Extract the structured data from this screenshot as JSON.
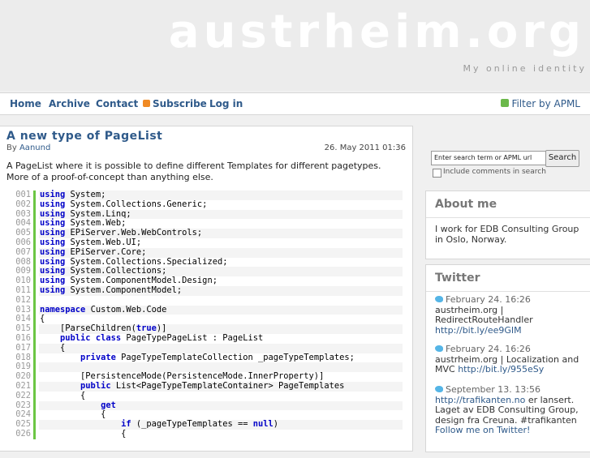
{
  "site": {
    "title": "austrheim.org",
    "tagline": "My online identity"
  },
  "nav": {
    "items": [
      "Home",
      "Archive",
      "Contact",
      "Subscribe",
      "Log in"
    ],
    "filter": "Filter by APML"
  },
  "post": {
    "title": "A new type of PageList",
    "by": "By",
    "author": "Aanund",
    "date": "26. May 2011 01:36",
    "intro": "A PageList where it is possible to define different Templates for different pagetypes. More of a proof-of-concept than anything else.",
    "code": [
      {
        "n": "001",
        "t": "<k>using</k> System;"
      },
      {
        "n": "002",
        "t": "<k>using</k> System.Collections.Generic;"
      },
      {
        "n": "003",
        "t": "<k>using</k> System.Linq;"
      },
      {
        "n": "004",
        "t": "<k>using</k> System.Web;"
      },
      {
        "n": "005",
        "t": "<k>using</k> EPiServer.Web.WebControls;"
      },
      {
        "n": "006",
        "t": "<k>using</k> System.Web.UI;"
      },
      {
        "n": "007",
        "t": "<k>using</k> EPiServer.Core;"
      },
      {
        "n": "008",
        "t": "<k>using</k> System.Collections.Specialized;"
      },
      {
        "n": "009",
        "t": "<k>using</k> System.Collections;"
      },
      {
        "n": "010",
        "t": "<k>using</k> System.ComponentModel.Design;"
      },
      {
        "n": "011",
        "t": "<k>using</k> System.ComponentModel;"
      },
      {
        "n": "012",
        "t": ""
      },
      {
        "n": "013",
        "t": "<k>namespace</k> Custom.Web.Code"
      },
      {
        "n": "014",
        "t": "{"
      },
      {
        "n": "015",
        "t": "    [ParseChildren(<k>true</k>)]"
      },
      {
        "n": "016",
        "t": "    <k>public</k> <k>class</k> PageTypePageList : PageList"
      },
      {
        "n": "017",
        "t": "    {"
      },
      {
        "n": "018",
        "t": "        <k>private</k> PageTypeTemplateCollection _pageTypeTemplates;"
      },
      {
        "n": "019",
        "t": ""
      },
      {
        "n": "020",
        "t": "        [PersistenceMode(PersistenceMode.InnerProperty)]"
      },
      {
        "n": "021",
        "t": "        <k>public</k> List<PageTypeTemplateContainer> PageTemplates"
      },
      {
        "n": "022",
        "t": "        {"
      },
      {
        "n": "023",
        "t": "            <k>get</k>"
      },
      {
        "n": "024",
        "t": "            {"
      },
      {
        "n": "025",
        "t": "                <k>if</k> (_pageTypeTemplates == <k>null</k>)"
      },
      {
        "n": "026",
        "t": "                {"
      }
    ]
  },
  "search": {
    "placeholder": "Enter search term or APML url",
    "button": "Search",
    "include_comments": "Include comments in search"
  },
  "about": {
    "title": "About me",
    "text": "I work for EDB Consulting Group in Oslo, Norway."
  },
  "twitter": {
    "title": "Twitter",
    "tweets": [
      {
        "date": "February 24. 16:26",
        "text": "austrheim.org | RedirectRouteHandler",
        "link": "http://bit.ly/ee9GIM"
      },
      {
        "date": "February 24. 16:26",
        "text": "austrheim.org | Localization and MVC",
        "link": "http://bit.ly/955eSy"
      },
      {
        "date": "September 13. 13:56",
        "link": "http://trafikanten.no",
        "text": "er lansert. Laget av EDB Consulting Group, design fra Creuna. #trafikanten"
      }
    ],
    "follow": "Follow me on Twitter!"
  },
  "colors": {
    "link": "#2f5a8a",
    "keyword": "#0000c8",
    "line_bar": "#6cc644"
  }
}
